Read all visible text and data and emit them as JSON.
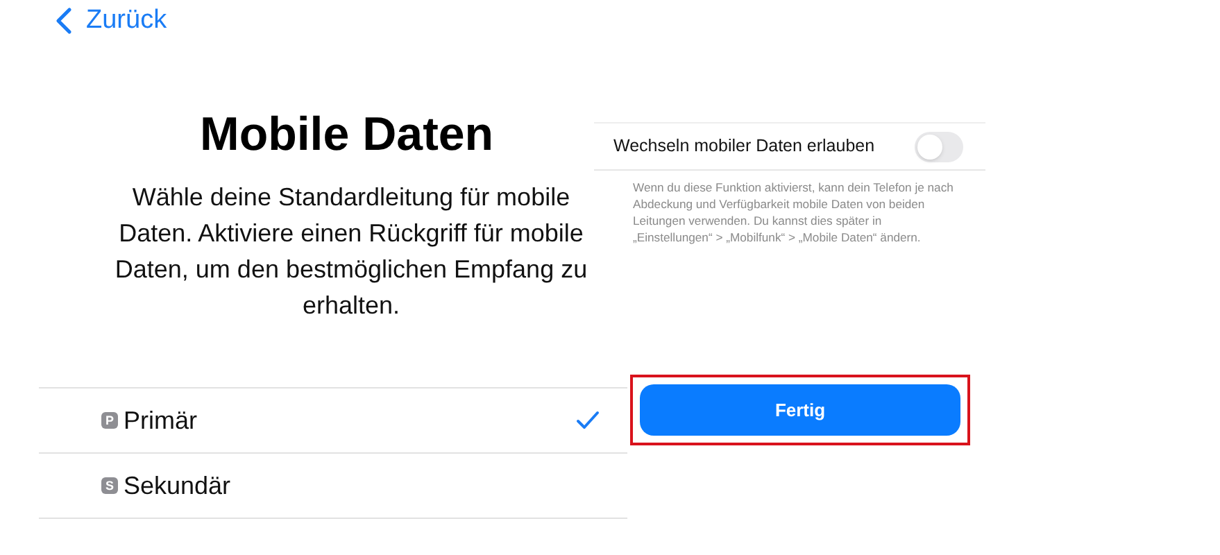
{
  "back_link": {
    "label": "Zurück"
  },
  "title": "Mobile Daten",
  "description": "Wähle deine Standardleitung für mobile Daten. Aktiviere einen Rückgriff für mobile Daten, um den bestmöglichen Empfang zu erhalten.",
  "lines": [
    {
      "badge": "P",
      "label": "Primär",
      "selected": true
    },
    {
      "badge": "S",
      "label": "Sekundär",
      "selected": false
    }
  ],
  "switch_setting": {
    "label": "Wechseln mobiler Daten erlauben",
    "on": false,
    "footnote": "Wenn du diese Funktion aktivierst, kann dein Telefon je nach Abdeckung und Verfügbarkeit mobile Daten von beiden Leitungen verwenden. Du kannst dies später in „Einstellungen“ > „Mobilfunk“ > „Mobile Daten“ ändern."
  },
  "done_button": {
    "label": "Fertig",
    "highlighted": true
  }
}
